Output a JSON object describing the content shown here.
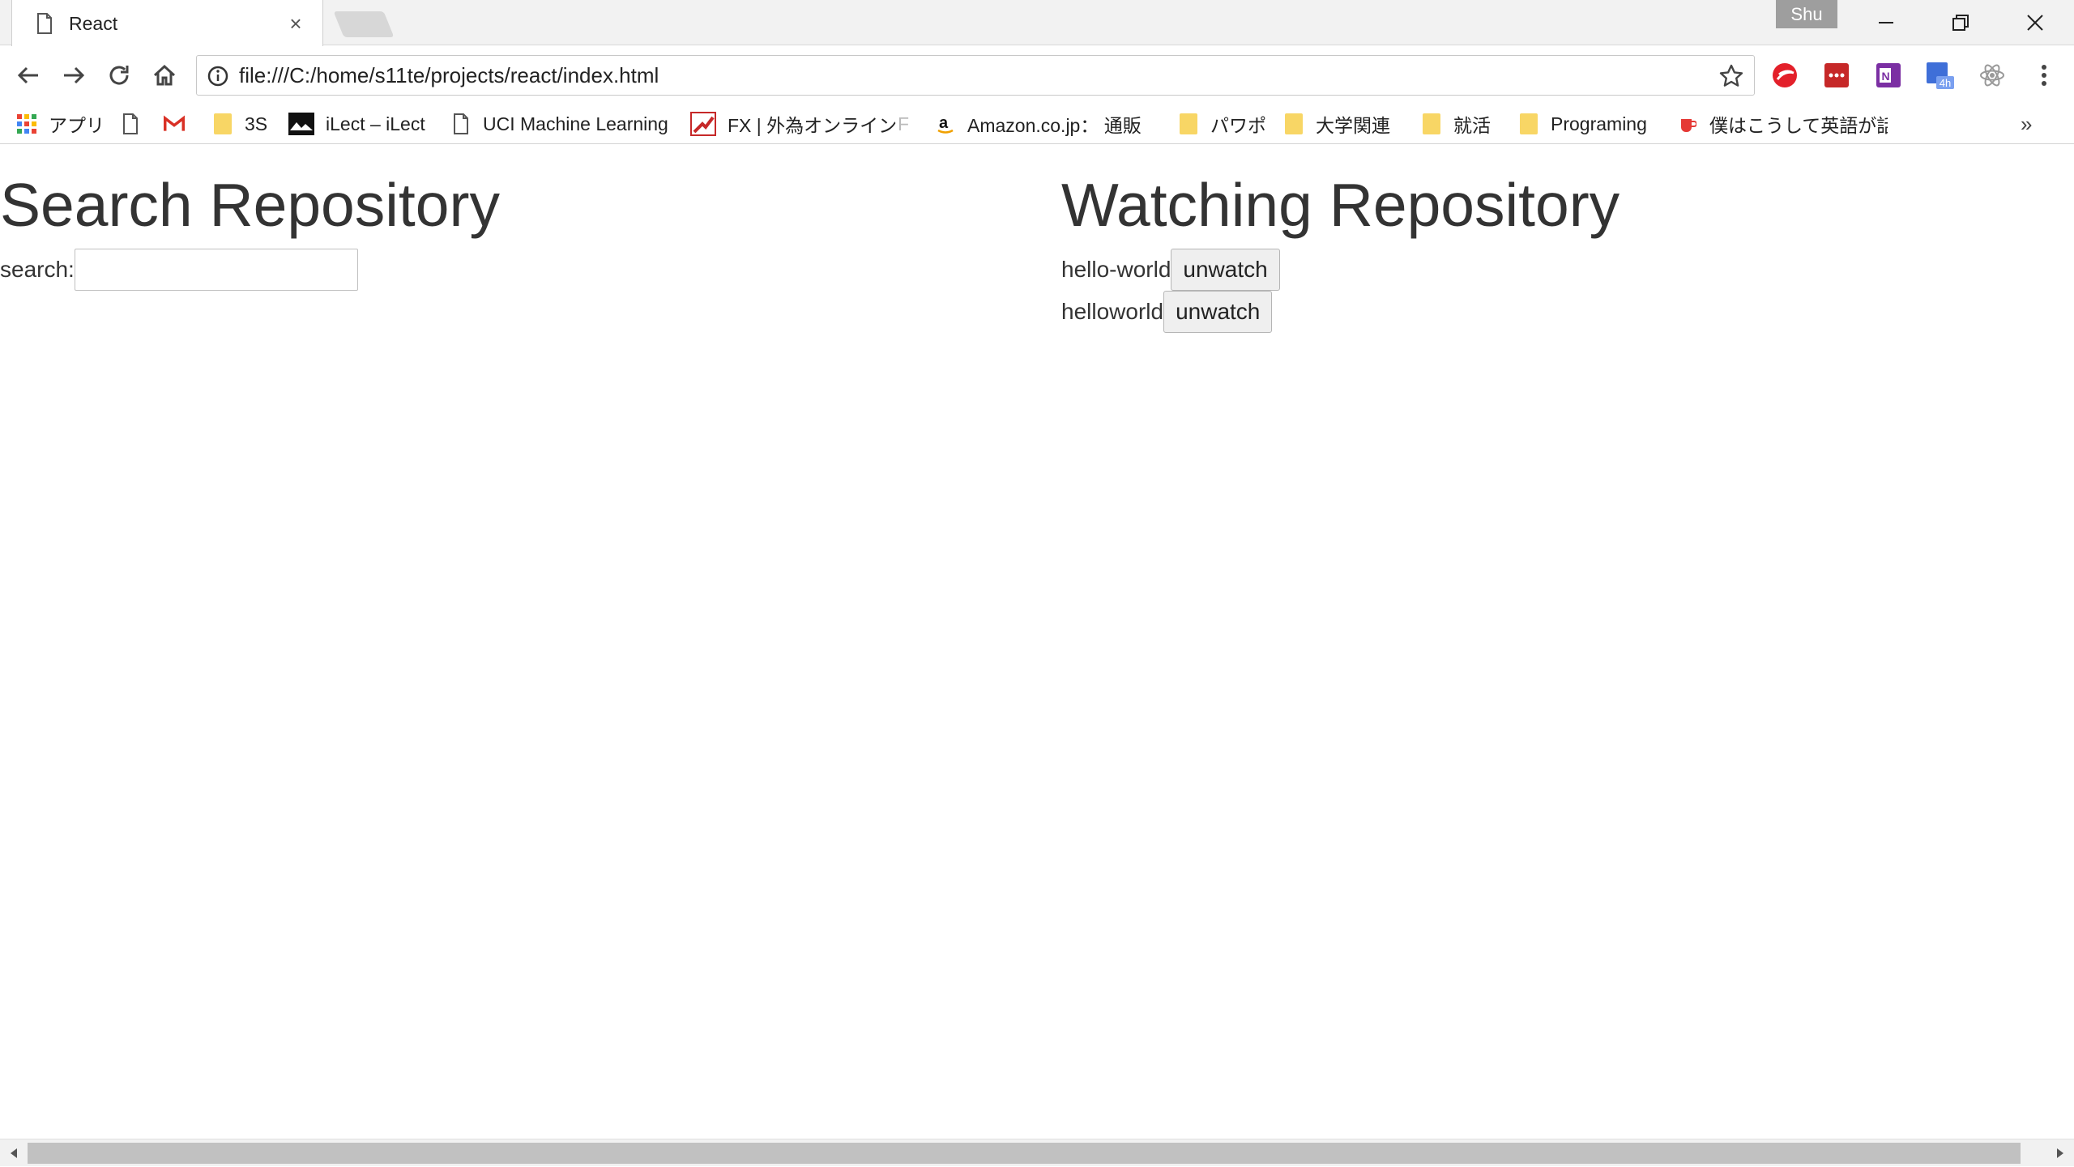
{
  "tab": {
    "title": "React",
    "close_glyph": "×"
  },
  "profile": {
    "name": "Shu"
  },
  "address_bar": {
    "url": "file:///C:/home/s11te/projects/react/index.html"
  },
  "bookmarks": [
    {
      "label": "アプリ",
      "icon": "apps-grid-icon"
    },
    {
      "label": "",
      "icon": "page-icon"
    },
    {
      "label": "",
      "icon": "gmail-icon"
    },
    {
      "label": "3S",
      "icon": "folder-icon"
    },
    {
      "label": "iLect – iLect",
      "icon": "ilect-icon"
    },
    {
      "label": "UCI Machine Learning",
      "icon": "page-icon"
    },
    {
      "label": "FX | 外為オンライン",
      "icon": "fx-icon"
    },
    {
      "label": "F",
      "icon": ""
    },
    {
      "label": "Amazon.co.jp： 通販",
      "icon": "amazon-icon"
    },
    {
      "label": "パワポ",
      "icon": "folder-icon"
    },
    {
      "label": "大学関連",
      "icon": "folder-icon"
    },
    {
      "label": "就活",
      "icon": "folder-icon"
    },
    {
      "label": "Programing",
      "icon": "folder-icon"
    },
    {
      "label": "僕はこうして英語が話せ",
      "icon": "coffee-icon"
    }
  ],
  "bookmarks_more": "»",
  "extensions": {
    "calendar_badge": "4h"
  },
  "search_section": {
    "heading": "Search Repository",
    "label": "search:",
    "input_value": "",
    "input_placeholder": ""
  },
  "watch_section": {
    "heading": "Watching Repository",
    "repos": [
      {
        "name": "hello-world",
        "button": "unwatch"
      },
      {
        "name": "helloworld",
        "button": "unwatch"
      }
    ]
  },
  "colors": {
    "chrome_bg": "#f2f2f2",
    "folder": "#f8d665",
    "text": "#333333"
  }
}
